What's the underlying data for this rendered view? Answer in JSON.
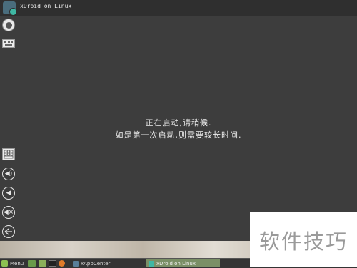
{
  "window": {
    "title": "xDroid on Linux",
    "message_line1": "正在启动,请稍候.",
    "message_line2": "如是第一次启动,则需要较长时间."
  },
  "toolbar": {
    "icons": [
      "record-icon",
      "keyboard-icon",
      "keymap-icon",
      "volume-up-icon",
      "volume-down-icon",
      "mute-icon",
      "back-icon"
    ]
  },
  "taskbar": {
    "menu_label": "Menu",
    "tasks": [
      {
        "label": "xAppCenter",
        "active": false
      },
      {
        "label": "xDroid on Linux",
        "active": true
      }
    ]
  },
  "watermark": {
    "text": "软件技巧"
  },
  "colors": {
    "window_bg": "#3d3d3d",
    "titlebar_bg": "#2f2f2f",
    "active_task": "#7a8f66",
    "accent": "#3fb8a4"
  }
}
